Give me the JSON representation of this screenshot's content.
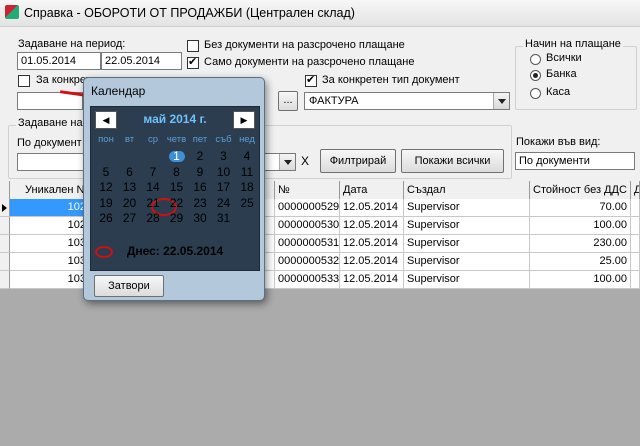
{
  "window": {
    "title": "Справка - ОБОРОТИ ОТ ПРОДАЖБИ (Централен склад)"
  },
  "period": {
    "label": "Задаване на период:",
    "from": "01.05.2014",
    "to": "22.05.2014"
  },
  "options": {
    "no_installment": {
      "label": "Без документи на разсрочено плащане",
      "checked": false
    },
    "only_installment": {
      "label": "Само документи на разсрочено плащане",
      "checked": true
    },
    "specific_partner": {
      "label": "За конкрет",
      "checked": false
    },
    "specific_doc_type": {
      "label": "За конкретен тип документ",
      "checked": true
    }
  },
  "doc_type": {
    "value": "ФАКТУРА"
  },
  "browse_button": {
    "label": "..."
  },
  "payment": {
    "title": "Начин на плащане",
    "options": [
      {
        "label": "Всички",
        "checked": false
      },
      {
        "label": "Банка",
        "checked": true
      },
      {
        "label": "Каса",
        "checked": false
      }
    ]
  },
  "filter_group": {
    "title": "Задаване на",
    "by_doc_label": "По документ",
    "clear_label": "X",
    "filter_button": "Филтрирай",
    "show_all_button": "Покажи всички",
    "view_label": "Покажи във вид:",
    "view_value": "По документи"
  },
  "table": {
    "columns": [
      "Уникален N",
      "№",
      "Дата",
      "Създал",
      "Стойност без ДДС",
      "Д"
    ],
    "rows": [
      {
        "id": "102",
        "num": "0000000529",
        "date": "12.05.2014",
        "by": "Supervisor",
        "value": "70.00",
        "selected": true
      },
      {
        "id": "102",
        "num": "0000000530",
        "date": "12.05.2014",
        "by": "Supervisor",
        "value": "100.00",
        "selected": false
      },
      {
        "id": "103",
        "num": "0000000531",
        "date": "12.05.2014",
        "by": "Supervisor",
        "value": "230.00",
        "selected": false
      },
      {
        "id": "103",
        "num": "0000000532",
        "date": "12.05.2014",
        "by": "Supervisor",
        "value": "25.00",
        "selected": false
      },
      {
        "id": "103",
        "num": "0000000533",
        "date": "12.05.2014",
        "by": "Supervisor",
        "value": "100.00",
        "selected": false
      }
    ]
  },
  "calendar": {
    "title": "Календар",
    "month_label": "май 2014 г.",
    "prev_icon": "◀",
    "next_icon": "▶",
    "weekdays": [
      "пон",
      "вт",
      "ср",
      "четв",
      "пет",
      "съб",
      "нед"
    ],
    "weeks": [
      [
        "",
        "",
        "",
        "1",
        "2",
        "3",
        "4"
      ],
      [
        "5",
        "6",
        "7",
        "8",
        "9",
        "10",
        "11"
      ],
      [
        "12",
        "13",
        "14",
        "15",
        "16",
        "17",
        "18"
      ],
      [
        "19",
        "20",
        "21",
        "22",
        "23",
        "24",
        "25"
      ],
      [
        "26",
        "27",
        "28",
        "29",
        "30",
        "31",
        ""
      ]
    ],
    "selected_day": "1",
    "today_day": "22",
    "today_label": "Днес: 22.05.2014",
    "close_button": "Затвори"
  },
  "colors": {
    "selection": "#3399ff",
    "calendar_bg": "#2b3d4f",
    "annotation": "#d01010"
  }
}
